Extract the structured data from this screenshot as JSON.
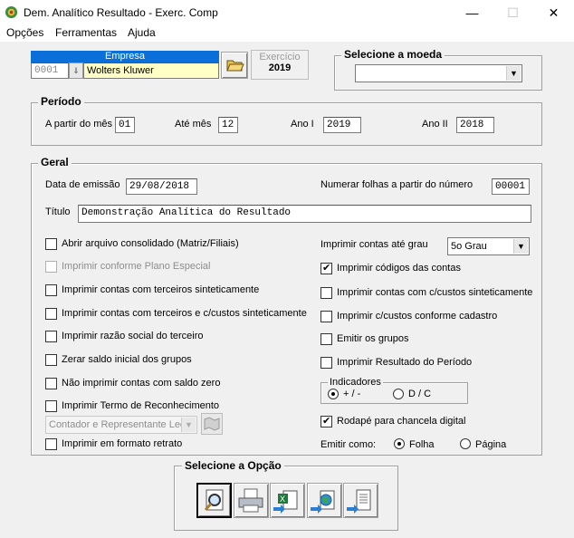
{
  "window": {
    "title": "Dem. Analítico Resultado - Exerc. Comp",
    "minimize": "—",
    "maximize": "☐",
    "close": "✕"
  },
  "menu": [
    "Opções",
    "Ferramentas",
    "Ajuda"
  ],
  "empresa": {
    "header": "Empresa",
    "code": "0001",
    "name": "Wolters Kluwer"
  },
  "exercicio": {
    "label": "Exercício",
    "value": "2019"
  },
  "moeda": {
    "title": "Selecione a moeda",
    "value": ""
  },
  "periodo": {
    "title": "Período",
    "a_partir_label": "A partir do mês",
    "a_partir_value": "01",
    "ate_label": "Até mês",
    "ate_value": "12",
    "ano1_label": "Ano I",
    "ano1_value": "2019",
    "ano2_label": "Ano II",
    "ano2_value": "2018"
  },
  "geral": {
    "title": "Geral",
    "emissao_label": "Data de emissão",
    "emissao_value": "29/08/2018",
    "numerar_label": "Numerar folhas a partir do número",
    "numerar_value": "00001",
    "titulo_label": "Título",
    "titulo_value": "Demonstração Analítica do Resultado",
    "left_checks": [
      {
        "label": "Abrir arquivo consolidado (Matriz/Filiais)",
        "checked": false,
        "disabled": false
      },
      {
        "label": "Imprimir conforme Plano Especial",
        "checked": false,
        "disabled": true
      },
      {
        "label": "Imprimir contas com terceiros sinteticamente",
        "checked": false,
        "disabled": false
      },
      {
        "label": "Imprimir contas com terceiros e c/custos sinteticamente",
        "checked": false,
        "disabled": false
      },
      {
        "label": "Imprimir razão social do terceiro",
        "checked": false,
        "disabled": false
      },
      {
        "label": "Zerar saldo inicial dos grupos",
        "checked": false,
        "disabled": false
      },
      {
        "label": "Não imprimir contas com saldo zero",
        "checked": false,
        "disabled": false
      },
      {
        "label": "Imprimir Termo de Reconhecimento",
        "checked": false,
        "disabled": false
      }
    ],
    "termo_combo": "Contador e Representante Leç",
    "retrato_label": "Imprimir em formato retrato",
    "grau_label": "Imprimir contas até grau",
    "grau_value": "5o Grau",
    "right_checks": [
      {
        "label": "Imprimir códigos das contas",
        "checked": true
      },
      {
        "label": "Imprimir contas com c/custos sinteticamente",
        "checked": false
      },
      {
        "label": "Imprimir c/custos conforme cadastro",
        "checked": false
      },
      {
        "label": "Emitir os grupos",
        "checked": false
      },
      {
        "label": "Imprimir Resultado do Período",
        "checked": false
      }
    ],
    "indicadores": {
      "title": "Indicadores",
      "opt1": "+ / -",
      "opt2": "D / C"
    },
    "rodape_label": "Rodapé para chancela digital",
    "emitir_label": "Emitir como:",
    "emitir_opt1": "Folha",
    "emitir_opt2": "Página"
  },
  "opcao": {
    "title": "Selecione a Opção"
  }
}
